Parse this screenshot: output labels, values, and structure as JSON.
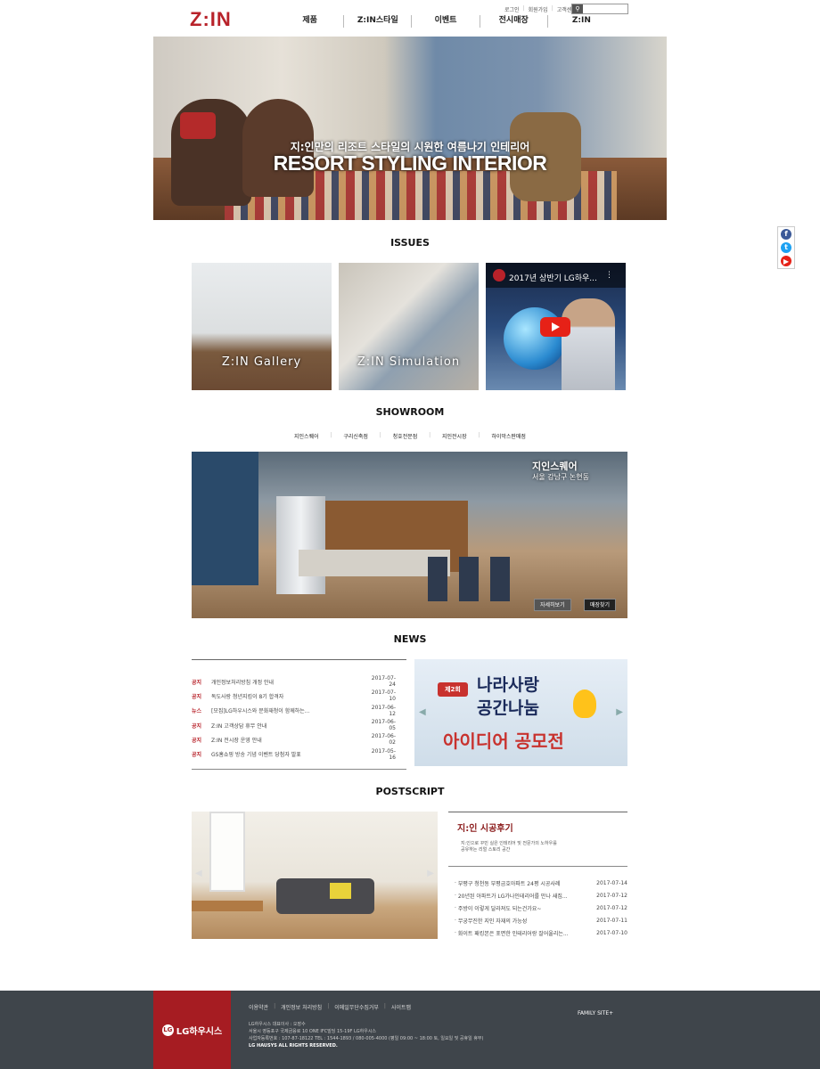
{
  "header": {
    "logo": "Z:IN",
    "util": [
      "로그인",
      "회원가입",
      "고객센터"
    ],
    "nav": [
      "제품",
      "Z:IN스타일",
      "이벤트",
      "전시매장",
      "Z:IN"
    ]
  },
  "hero": {
    "subtitle": "지:인만의 리조트 스타일의 시원한 여름나기 인테리어",
    "title": "RESORT STYLING INTERIOR"
  },
  "social": {
    "icons": [
      "facebook-icon",
      "twitter-icon",
      "youtube-icon"
    ],
    "colors": [
      "#3b5998",
      "#1da1f2",
      "#e62117"
    ]
  },
  "issues": {
    "title": "ISSUES",
    "tiles": [
      "Z:IN Gallery",
      "Z:IN Simulation"
    ],
    "video_title": "2017년 상반기 LG하우..."
  },
  "showroom": {
    "title": "SHOWROOM",
    "tabs": [
      "지인스퀘어",
      "구리신축점",
      "청호전문점",
      "지인전시장",
      "하이막스판매점"
    ],
    "name": "지인스퀘어",
    "address": "서울 강남구 논현동",
    "btn_detail": "자세히보기",
    "btn_find": "매장찾기"
  },
  "news": {
    "title": "NEWS",
    "rows": [
      {
        "cat": "공지",
        "title": "개인정보처리방침 개정 안내",
        "date": "2017-07-24"
      },
      {
        "cat": "공지",
        "title": "독도사랑 청년지킴이 8기 합격자",
        "date": "2017-07-10"
      },
      {
        "cat": "뉴스",
        "title": "[모집]LG하우시스와 문화재청이 함께하는...",
        "date": "2017-06-12"
      },
      {
        "cat": "공지",
        "title": "Z:IN 고객상담 휴무 안내",
        "date": "2017-06-05"
      },
      {
        "cat": "공지",
        "title": "Z:IN 전시장 운영 안내",
        "date": "2017-06-02"
      },
      {
        "cat": "공지",
        "title": "GS홈쇼핑 방송 기념 이벤트 당첨자 발표",
        "date": "2017-05-16"
      }
    ],
    "banner": {
      "badge": "제2회",
      "line1": "나라사랑",
      "line2": "공간나눔",
      "line3": "아이디어 공모전"
    }
  },
  "postscript": {
    "title": "POSTSCRIPT",
    "box_title": "지:인 시공후기",
    "desc1": "지:인으로 꾸민 실은 인테리어 및 전문가의 노하우를",
    "desc2": "공유하는 리얼 스토리 공간",
    "rows": [
      {
        "title": "부평구 청천동 부평금호아파트 24평 시공사례",
        "date": "2017-07-14"
      },
      {
        "title": "20년된 아파트가 LG가나인테리어를 만나 새집...",
        "date": "2017-07-12"
      },
      {
        "title": "주방이 이렇게 달라져도 되는건가요~",
        "date": "2017-07-12"
      },
      {
        "title": "무궁무진한 지인 자재의 가능성",
        "date": "2017-07-11"
      },
      {
        "title": "화이트 패킹본은 포면한 인테리어랑 잘어울리는...",
        "date": "2017-07-10"
      }
    ]
  },
  "footer": {
    "brand": "LG하우시스",
    "links": [
      "이용약관",
      "개인정보 처리방침",
      "이메일무단수집거부",
      "사이트맵"
    ],
    "info1": "LG하우시스 대표이사 : 오장수",
    "info2": "서울시 영등포구 국제금융로 10 ONE IFC빌딩 15-19F LG하우시스",
    "info3": "사업자등록번호 : 107-87-18122 TEL : 1544-1893 / 080-005-4000 (평일 09:00 ~ 18:00 토, 일요일 및 공휴일 휴무)",
    "info4": "LG HAUSYS ALL RIGHTS RESERVED.",
    "family": "FAMILY SITE+"
  }
}
